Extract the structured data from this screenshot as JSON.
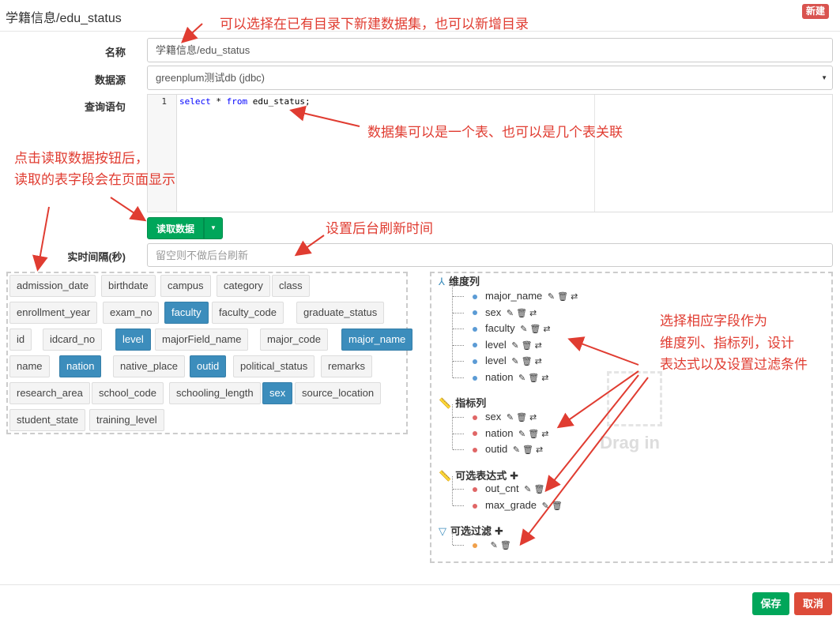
{
  "header": {
    "title": "学籍信息/edu_status",
    "new_label": "新建"
  },
  "form": {
    "name_label": "名称",
    "name_value": "学籍信息/edu_status",
    "source_label": "数据源",
    "source_value": "greenplum测试db (jdbc)",
    "query_label": "查询语句",
    "query_line": "1",
    "query_select": "select",
    "query_star": " * ",
    "query_from": "from",
    "query_table": " edu_status;",
    "read_button": "读取数据",
    "interval_label": "实时间隔(秒)",
    "interval_placeholder": "留空则不做后台刷新"
  },
  "fields": [
    {
      "label": "admission_date",
      "selected": false
    },
    {
      "label": "birthdate",
      "selected": false
    },
    {
      "label": "campus",
      "selected": false
    },
    {
      "label": "category",
      "selected": false
    },
    {
      "label": "class",
      "selected": false
    },
    {
      "label": "enrollment_year",
      "selected": false
    },
    {
      "label": "exam_no",
      "selected": false
    },
    {
      "label": "faculty",
      "selected": true
    },
    {
      "label": "faculty_code",
      "selected": false
    },
    {
      "label": "graduate_status",
      "selected": false
    },
    {
      "label": "id",
      "selected": false
    },
    {
      "label": "idcard_no",
      "selected": false
    },
    {
      "label": "level",
      "selected": true
    },
    {
      "label": "majorField_name",
      "selected": false
    },
    {
      "label": "major_code",
      "selected": false
    },
    {
      "label": "major_name",
      "selected": true
    },
    {
      "label": "name",
      "selected": false
    },
    {
      "label": "nation",
      "selected": true
    },
    {
      "label": "native_place",
      "selected": false
    },
    {
      "label": "outid",
      "selected": true
    },
    {
      "label": "political_status",
      "selected": false
    },
    {
      "label": "remarks",
      "selected": false
    },
    {
      "label": "research_area",
      "selected": false
    },
    {
      "label": "school_code",
      "selected": false
    },
    {
      "label": "schooling_length",
      "selected": false
    },
    {
      "label": "sex",
      "selected": true
    },
    {
      "label": "source_location",
      "selected": false
    },
    {
      "label": "student_state",
      "selected": false
    },
    {
      "label": "training_level",
      "selected": false
    }
  ],
  "panel": {
    "dimensions_title": "维度列",
    "dimensions": [
      "major_name",
      "sex",
      "faculty",
      "level",
      "level",
      "nation"
    ],
    "metrics_title": "指标列",
    "metrics": [
      "sex",
      "nation",
      "outid"
    ],
    "expressions_title": "可选表达式",
    "expressions": [
      "out_cnt",
      "max_grade"
    ],
    "filters_title": "可选过滤",
    "filters": [
      ""
    ],
    "drag_hint": "Drag in"
  },
  "annotations": {
    "a1": "可以选择在已有目录下新建数据集，也可以新增目录",
    "a2": "数据集可以是一个表、也可以是几个表关联",
    "a3_line1": "点击读取数据按钮后，",
    "a3_line2": "读取的表字段会在页面显示",
    "a4": "设置后台刷新时间",
    "a5_line1": "选择相应字段作为",
    "a5_line2": "维度列、指标列，设计",
    "a5_line3": "表达式以及设置过滤条件"
  },
  "footer": {
    "save": "保存",
    "cancel": "取消"
  },
  "colors": {
    "primary": "#3c8dbc",
    "success": "#00a65a",
    "danger": "#dd4b39",
    "annotation": "#e03c31"
  }
}
